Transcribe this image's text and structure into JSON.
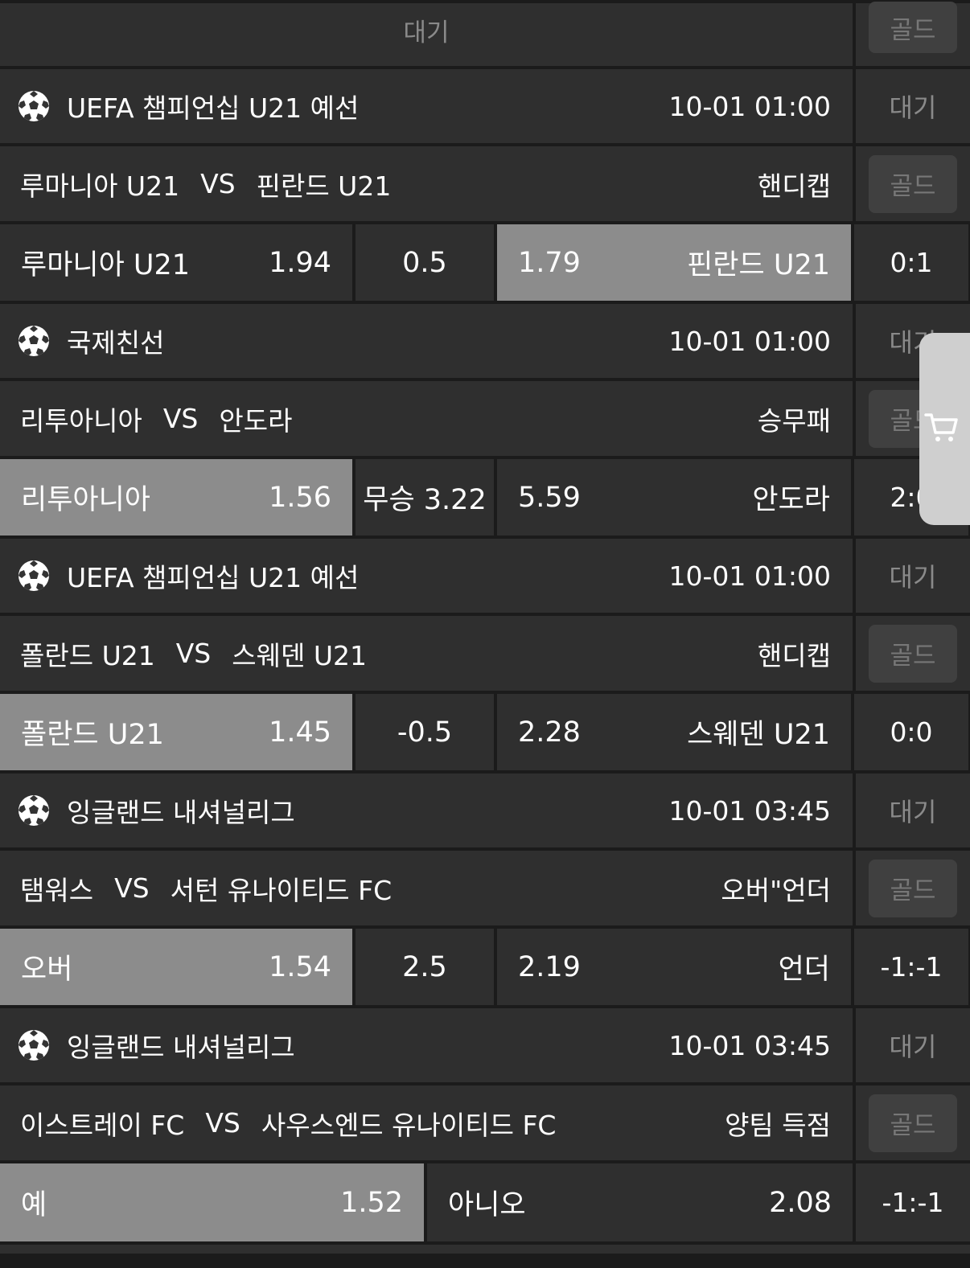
{
  "top": {
    "status": "대기",
    "gold": "골드"
  },
  "games": [
    {
      "league": "UEFA 챔피언십 U21 예선",
      "time": "10-01 01:00",
      "status": "대기",
      "home": "루마니아 U21",
      "vs": "VS",
      "away": "핀란드 U21",
      "market": "핸디캡",
      "gold": "골드",
      "odds": {
        "home_name": "루마니아 U21",
        "home_odd": "1.94",
        "mid": "0.5",
        "away_odd": "1.79",
        "away_name": "핀란드 U21"
      },
      "score": "0:1",
      "selected": "away"
    },
    {
      "league": "국제친선",
      "time": "10-01 01:00",
      "status": "대기",
      "home": "리투아니아",
      "vs": "VS",
      "away": "안도라",
      "market": "승무패",
      "gold": "골드",
      "odds": {
        "home_name": "리투아니아",
        "home_odd": "1.56",
        "mid": "무승 3.22",
        "away_odd": "5.59",
        "away_name": "안도라"
      },
      "score": "2:0",
      "selected": "home"
    },
    {
      "league": "UEFA 챔피언십 U21 예선",
      "time": "10-01 01:00",
      "status": "대기",
      "home": "폴란드 U21",
      "vs": "VS",
      "away": "스웨덴 U21",
      "market": "핸디캡",
      "gold": "골드",
      "odds": {
        "home_name": "폴란드 U21",
        "home_odd": "1.45",
        "mid": "-0.5",
        "away_odd": "2.28",
        "away_name": "스웨덴 U21"
      },
      "score": "0:0",
      "selected": "home"
    },
    {
      "league": "잉글랜드 내셔널리그",
      "time": "10-01 03:45",
      "status": "대기",
      "home": "탬워스",
      "vs": "VS",
      "away": "서턴 유나이티드 FC",
      "market": "오버\"언더",
      "gold": "골드",
      "odds": {
        "home_name": "오버",
        "home_odd": "1.54",
        "mid": "2.5",
        "away_odd": "2.19",
        "away_name": "언더"
      },
      "score": "-1:-1",
      "selected": "home"
    },
    {
      "league": "잉글랜드 내셔널리그",
      "time": "10-01 03:45",
      "status": "대기",
      "home": "이스트레이 FC",
      "vs": "VS",
      "away": "사우스엔드 유나이티드 FC",
      "market": "양팀 득점",
      "gold": "골드",
      "odds": {
        "home_name": "예",
        "home_odd": "1.52",
        "away_name": "아니오",
        "away_odd": "2.08"
      },
      "score": "-1:-1",
      "selected": "home"
    }
  ],
  "colors": {
    "bg": "#1b1b1b",
    "cell": "#2f2f2f",
    "selected": "#8c8c8c",
    "muted": "#8a8a8a"
  },
  "icons": {
    "sport": "soccer-ball-icon",
    "cart": "cart-icon"
  }
}
